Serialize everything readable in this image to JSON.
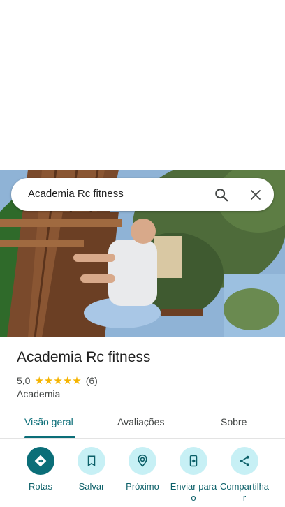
{
  "search": {
    "query": "Academia Rc fitness",
    "search_icon": "search-icon",
    "close_icon": "close-icon"
  },
  "photo": {
    "description_icon": "place-photo"
  },
  "place": {
    "name": "Academia Rc fitness",
    "rating": "5,0",
    "stars": 5,
    "review_count": "(6)",
    "category": "Academia"
  },
  "tabs": [
    {
      "label": "Visão geral",
      "active": true
    },
    {
      "label": "Avaliações",
      "active": false
    },
    {
      "label": "Sobre",
      "active": false
    }
  ],
  "actions": [
    {
      "label": "Rotas",
      "icon": "directions-icon"
    },
    {
      "label": "Salvar",
      "icon": "bookmark-icon"
    },
    {
      "label": "Próximo",
      "icon": "nearby-icon"
    },
    {
      "label": "Enviar para o",
      "icon": "send-to-phone-icon"
    },
    {
      "label": "Compartilhar",
      "icon": "share-icon"
    }
  ],
  "colors": {
    "accent": "#0b6e78",
    "action_bg": "#c7f0f5",
    "star": "#f5b400"
  }
}
